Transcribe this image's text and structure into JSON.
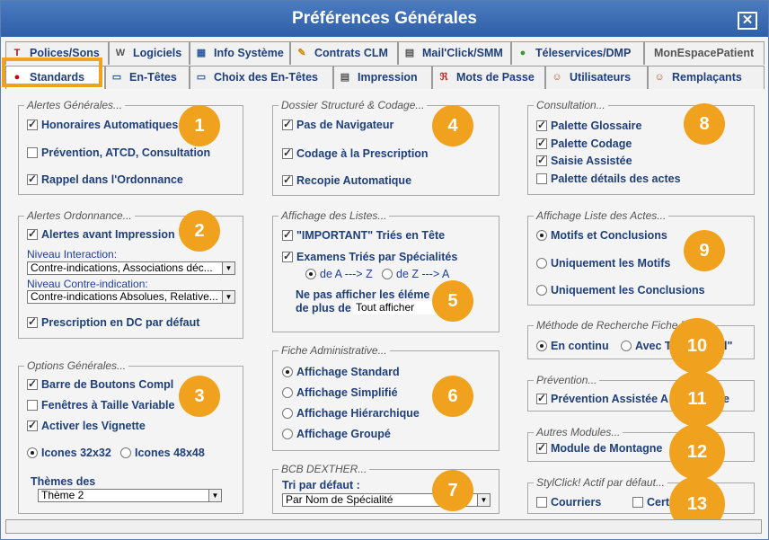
{
  "window": {
    "title": "Préférences Générales",
    "close_label": "✕"
  },
  "tabs_row1": [
    {
      "label": "Polices/Sons",
      "icon": "T"
    },
    {
      "label": "Logiciels",
      "icon": "W"
    },
    {
      "label": "Info Système",
      "icon": "▦"
    },
    {
      "label": "Contrats CLM",
      "icon": "✎"
    },
    {
      "label": "Mail'Click/SMM",
      "icon": "▤"
    },
    {
      "label": "Téleservices/DMP",
      "icon": "●"
    },
    {
      "label": "MonEspacePatient",
      "icon": ""
    }
  ],
  "tabs_row2": [
    {
      "label": "Standards",
      "icon": "●"
    },
    {
      "label": "En-Têtes",
      "icon": "▭"
    },
    {
      "label": "Choix des En-Têtes",
      "icon": "▭"
    },
    {
      "label": "Impression",
      "icon": "▤"
    },
    {
      "label": "Mots de Passe",
      "icon": "ℜ"
    },
    {
      "label": "Utilisateurs",
      "icon": "☺"
    },
    {
      "label": "Remplaçants",
      "icon": "☺"
    }
  ],
  "groups": {
    "alertes_generales": {
      "title": "Alertes Générales...",
      "items": [
        {
          "label": "Honoraires Automatiques",
          "checked": true
        },
        {
          "label": "Prévention, ATCD, Consultation",
          "checked": false
        },
        {
          "label": "Rappel dans l'Ordonnance",
          "checked": true
        }
      ]
    },
    "alertes_ordonnance": {
      "title": "Alertes Ordonnance...",
      "alert_label": "Alertes avant Impression",
      "niveau_interaction_label": "Niveau Interaction:",
      "niveau_interaction_value": "Contre-indications, Associations déc...",
      "niveau_ci_label": "Niveau Contre-indication:",
      "niveau_ci_value": "Contre-indications Absolues, Relative...",
      "dc_label": "Prescription en DC par défaut"
    },
    "options_generales": {
      "title": "Options Générales...",
      "items": [
        {
          "label": "Barre de Boutons Compl",
          "checked": true
        },
        {
          "label": "Fenêtres à Taille Variable",
          "checked": false
        },
        {
          "label": "Activer les Vignette",
          "checked": true
        }
      ],
      "icones32": "Icones 32x32",
      "icones48": "Icones 48x48",
      "themes_label": "Thèmes des",
      "theme_value": "Thème 2"
    },
    "dossier_structure": {
      "title": "Dossier Structuré & Codage...",
      "items": [
        {
          "label": "Pas de Navigateur",
          "checked": true
        },
        {
          "label": "Codage à la Prescription",
          "checked": true
        },
        {
          "label": "Recopie Automatique",
          "checked": true
        }
      ]
    },
    "affichage_listes": {
      "title": "Affichage des Listes...",
      "important_label": "\"IMPORTANT\" Triés en Tête",
      "examens_label": "Examens Triés par Spécialités",
      "az_label": "de A ---> Z",
      "za_label": "de Z ---> A",
      "ne_pas_label_1": "Ne pas afficher les éléme",
      "ne_pas_label_2": "de plus de",
      "tout_afficher": "Tout afficher"
    },
    "fiche_admin": {
      "title": "Fiche Administrative...",
      "items": [
        {
          "label": "Affichage Standard",
          "selected": true
        },
        {
          "label": "Affichage Simplifié",
          "selected": false
        },
        {
          "label": "Affichage Hiérarchique",
          "selected": false
        },
        {
          "label": "Affichage Groupé",
          "selected": false
        }
      ]
    },
    "bcb": {
      "title": "BCB DEXTHER...",
      "tri_label": "Tri par défaut :",
      "tri_value": "Par Nom de Spécialité"
    },
    "consultation": {
      "title": "Consultation...",
      "items": [
        {
          "label": "Palette Glossaire",
          "checked": true
        },
        {
          "label": "Palette Codage",
          "checked": true
        },
        {
          "label": "Saisie Assistée",
          "checked": true
        },
        {
          "label": "Palette détails des actes",
          "checked": false
        }
      ]
    },
    "liste_actes": {
      "title": "Affichage Liste des Actes...",
      "items": [
        {
          "label": "Motifs et Conclusions",
          "selected": true
        },
        {
          "label": "Uniquement les Motifs",
          "selected": false
        },
        {
          "label": "Uniquement les Conclusions",
          "selected": false
        }
      ]
    },
    "methode": {
      "title": "Méthode de Recherche Fiche T...",
      "continu": "En continu",
      "avec": "Avec T",
      "avec_tail": "l\""
    },
    "prevention": {
      "title": "Prévention...",
      "label": "Prévention Assistée A",
      "label_tail": "e"
    },
    "autres": {
      "title": "Autres Modules...",
      "label": "Module de Montagne"
    },
    "styl": {
      "title": "StylClick! Actif par défaut...",
      "courriers": "Courriers",
      "cert": "Cert"
    }
  },
  "badges": [
    "1",
    "2",
    "3",
    "4",
    "5",
    "6",
    "7",
    "8",
    "9",
    "10",
    "11",
    "12",
    "13"
  ],
  "colors": {
    "accent": "#f0a21e",
    "title_bar": "#3b6db5",
    "label_blue": "#1f3f7a"
  }
}
